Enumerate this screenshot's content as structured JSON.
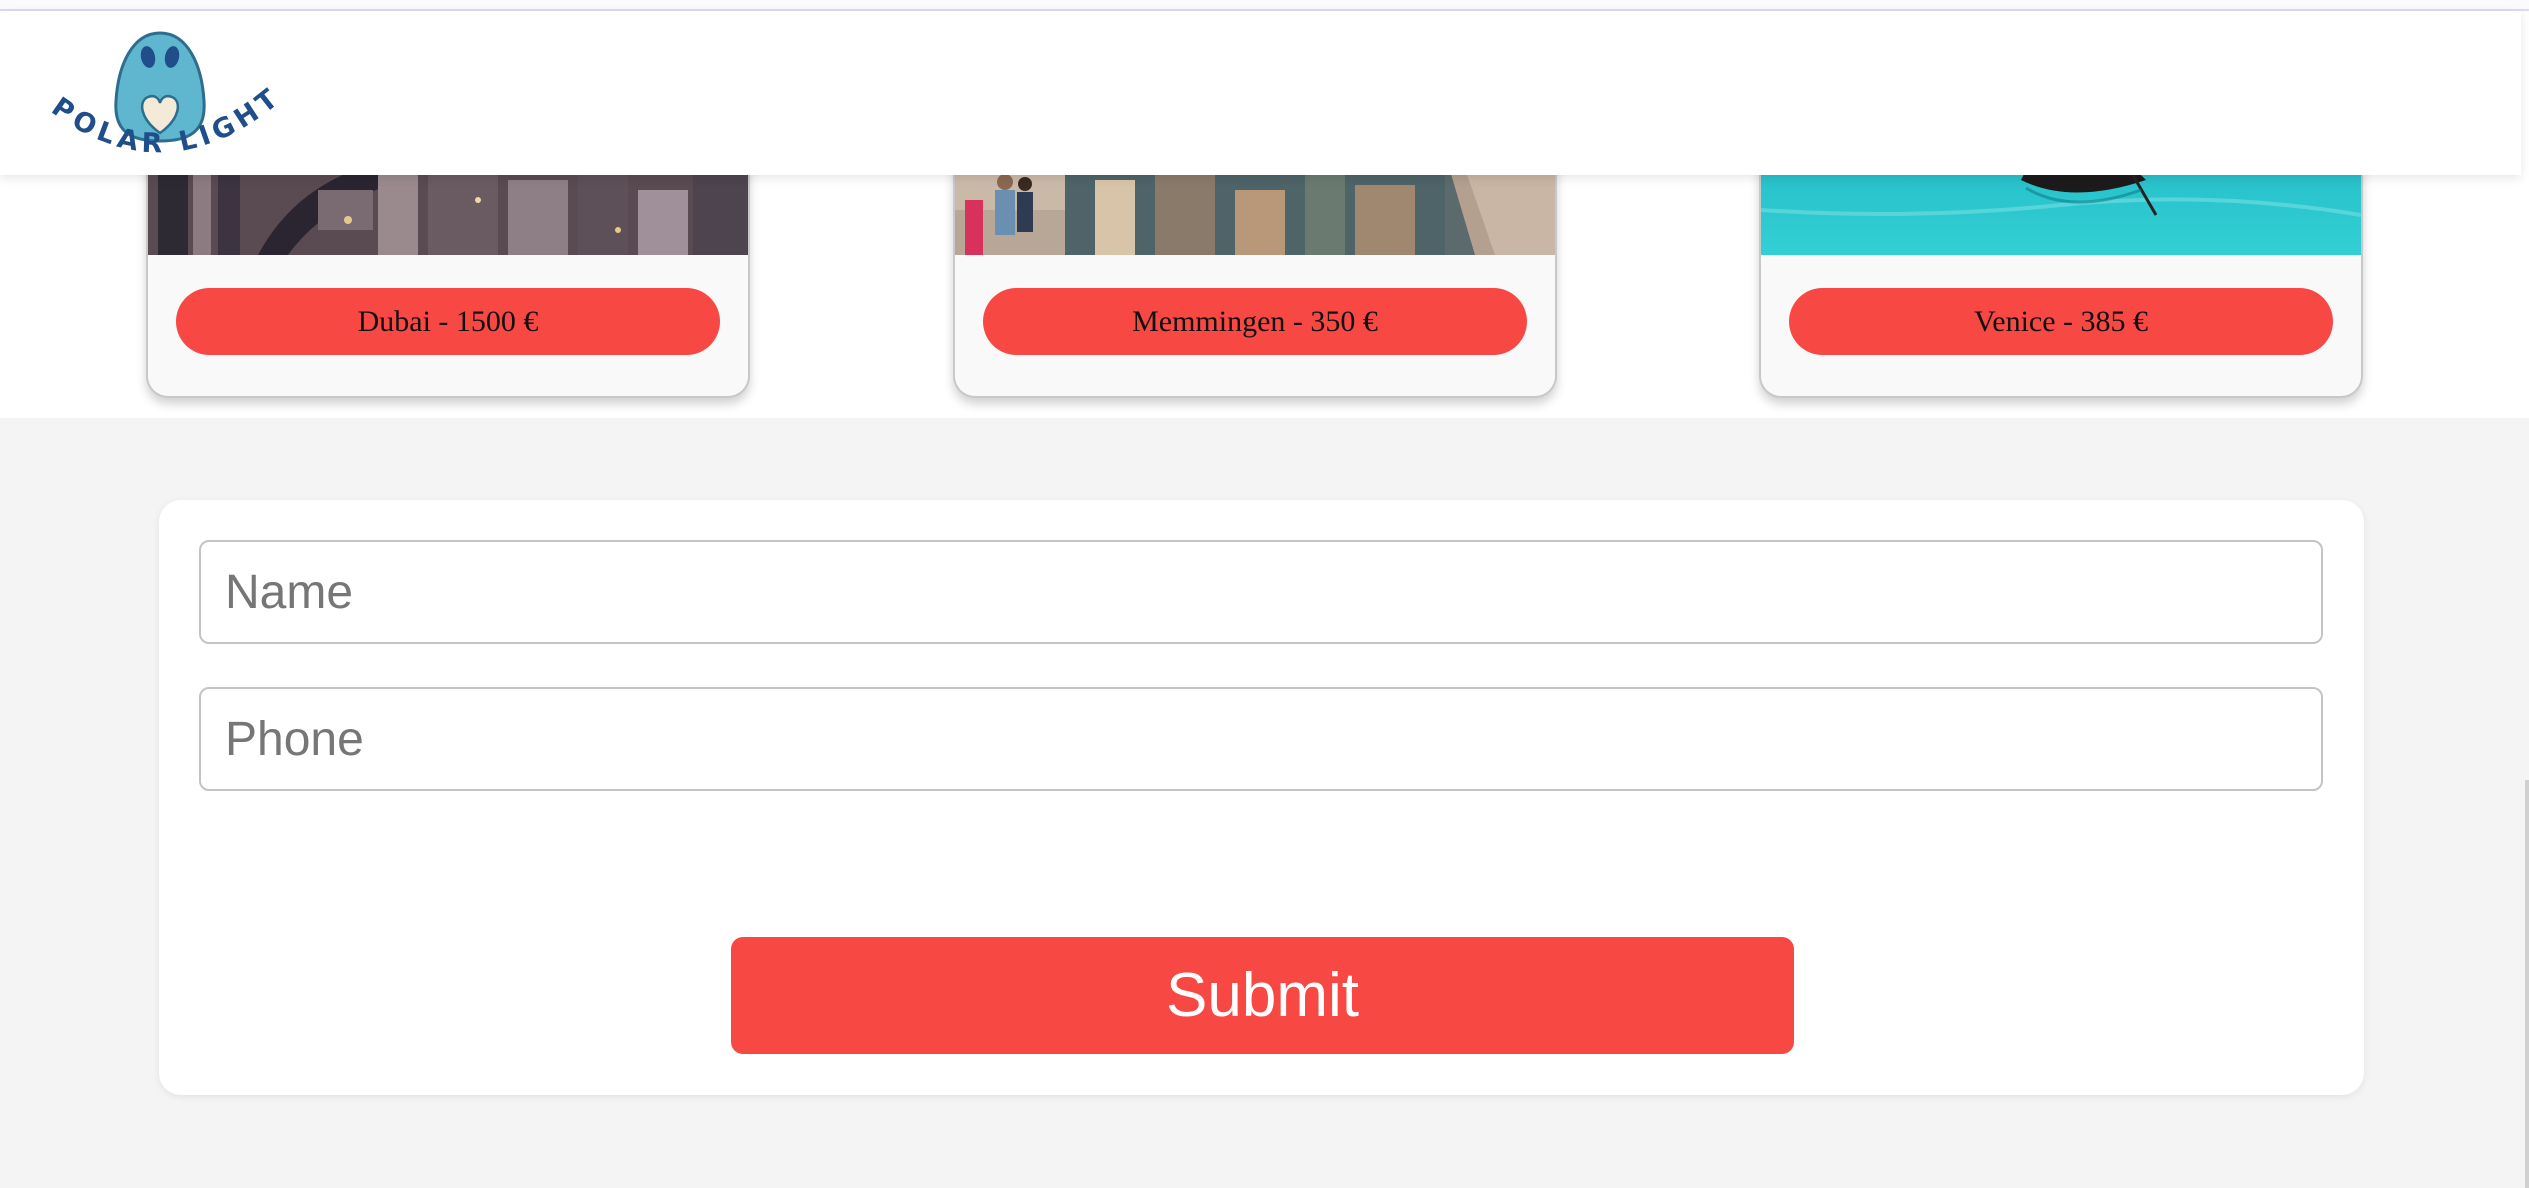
{
  "brand": {
    "logo_text": "POLAR LIGHTS",
    "accent_color": "#f74843"
  },
  "destinations": [
    {
      "label": "Dubai - 1500 €",
      "image": "dubai-city-aerial"
    },
    {
      "label": "Memmingen - 350 €",
      "image": "memmingen-canal"
    },
    {
      "label": "Venice - 385 €",
      "image": "venice-gondola"
    }
  ],
  "form": {
    "name_placeholder": "Name",
    "phone_placeholder": "Phone",
    "submit_label": "Submit"
  }
}
